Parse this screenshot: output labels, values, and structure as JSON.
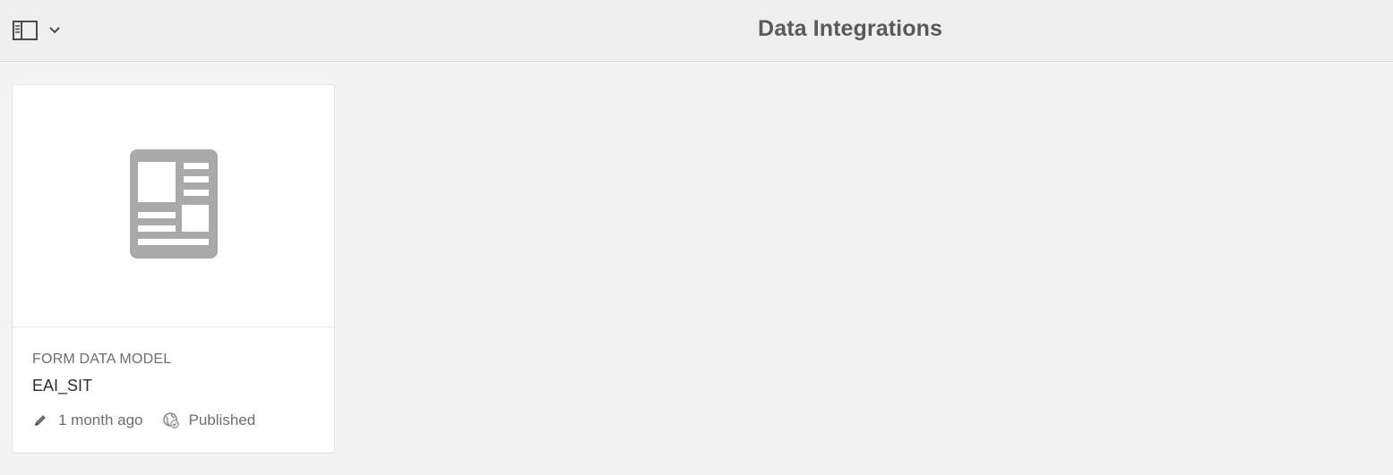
{
  "header": {
    "title": "Data Integrations",
    "rail_toggle_icon": "sidebar-panel-icon",
    "chevron_icon": "chevron-down-icon"
  },
  "cards": [
    {
      "thumbnail_icon": "form-document-icon",
      "type_label": "FORM DATA MODEL",
      "name": "EAI_SIT",
      "modified": "1 month ago",
      "modified_icon": "pencil-icon",
      "status": "Published",
      "status_icon": "globe-check-icon"
    }
  ],
  "colors": {
    "background": "#f4f4f4",
    "topbar": "#efefef",
    "card": "#ffffff",
    "icon_gray": "#a9a9a9",
    "title": "#5a5a5a"
  }
}
